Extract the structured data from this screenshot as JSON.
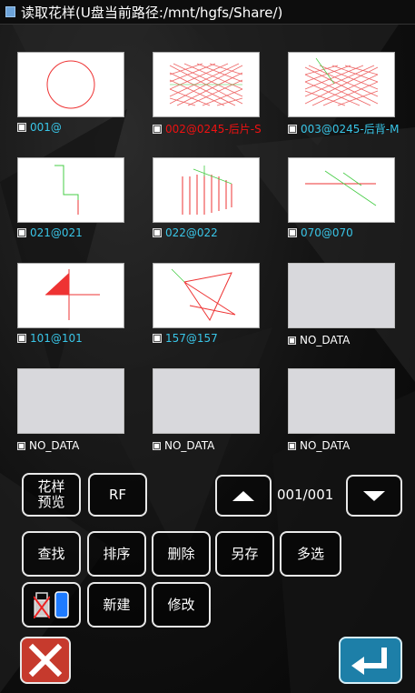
{
  "title": "读取花样(U盘当前路径:/mnt/hgfs/Share/)",
  "patterns": [
    {
      "label": "001@",
      "empty": false,
      "color": "cyan"
    },
    {
      "label": "002@0245-后片-S",
      "empty": false,
      "color": "red"
    },
    {
      "label": "003@0245-后背-M",
      "empty": false,
      "color": "cyan"
    },
    {
      "label": "021@021",
      "empty": false,
      "color": "cyan"
    },
    {
      "label": "022@022",
      "empty": false,
      "color": "cyan"
    },
    {
      "label": "070@070",
      "empty": false,
      "color": "cyan"
    },
    {
      "label": "101@101",
      "empty": false,
      "color": "cyan"
    },
    {
      "label": "157@157",
      "empty": false,
      "color": "cyan"
    },
    {
      "label": "NO_DATA",
      "empty": true,
      "color": "white"
    },
    {
      "label": "NO_DATA",
      "empty": true,
      "color": "white"
    },
    {
      "label": "NO_DATA",
      "empty": true,
      "color": "white"
    },
    {
      "label": "NO_DATA",
      "empty": true,
      "color": "white"
    }
  ],
  "controls": {
    "preview": "花样\n预览",
    "rf": "RF",
    "page": "001/001",
    "find": "查找",
    "sort": "排序",
    "delete": "删除",
    "save_as": "另存",
    "multi_select": "多选",
    "new": "新建",
    "modify": "修改"
  },
  "icons": {
    "close": "close-icon",
    "enter": "enter-return-icon",
    "usb_disabled": "usb-disabled-icon",
    "phone": "phone-storage-icon",
    "page_up": "triangle-up-icon",
    "page_down": "triangle-down-icon"
  },
  "colors": {
    "caption_cyan": "#39c6e8",
    "caption_selected": "#e11111",
    "close_bg": "#c63a2d",
    "enter_bg": "#1d7fa8"
  }
}
